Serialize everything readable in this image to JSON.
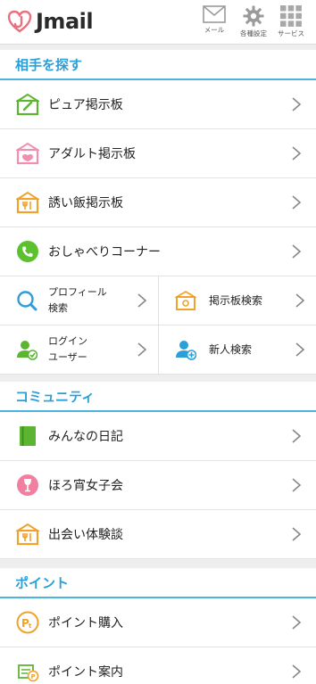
{
  "header": {
    "logo_text": "Jmail",
    "buttons": [
      {
        "label": "メール",
        "icon": "mail-icon"
      },
      {
        "label": "各種設定",
        "icon": "gear-icon"
      },
      {
        "label": "サービス",
        "icon": "grid-icon"
      }
    ]
  },
  "sections": {
    "find": {
      "title": "相手を探す",
      "items": [
        {
          "label": "ピュア掲示板",
          "icon": "pure-board-icon"
        },
        {
          "label": "アダルト掲示板",
          "icon": "adult-board-icon"
        },
        {
          "label": "誘い飯掲示板",
          "icon": "meal-board-icon"
        },
        {
          "label": "おしゃべりコーナー",
          "icon": "phone-icon"
        }
      ],
      "grid": [
        {
          "line1": "プロフィール",
          "line2": "検索",
          "icon": "search-icon"
        },
        {
          "label": "掲示板検索",
          "icon": "board-search-icon"
        },
        {
          "line1": "ログイン",
          "line2": "ユーザー",
          "icon": "login-user-icon"
        },
        {
          "label": "新人検索",
          "icon": "new-user-icon"
        }
      ]
    },
    "community": {
      "title": "コミュニティ",
      "items": [
        {
          "label": "みんなの日記",
          "icon": "diary-icon"
        },
        {
          "label": "ほろ宵女子会",
          "icon": "wine-icon"
        },
        {
          "label": "出会い体験談",
          "icon": "experience-board-icon"
        }
      ]
    },
    "points": {
      "title": "ポイント",
      "items": [
        {
          "label": "ポイント購入",
          "icon": "point-coin-icon"
        },
        {
          "label": "ポイント案内",
          "icon": "point-guide-icon"
        }
      ]
    }
  },
  "colors": {
    "accent": "#2a9fd8",
    "logo": "#e8707f"
  }
}
